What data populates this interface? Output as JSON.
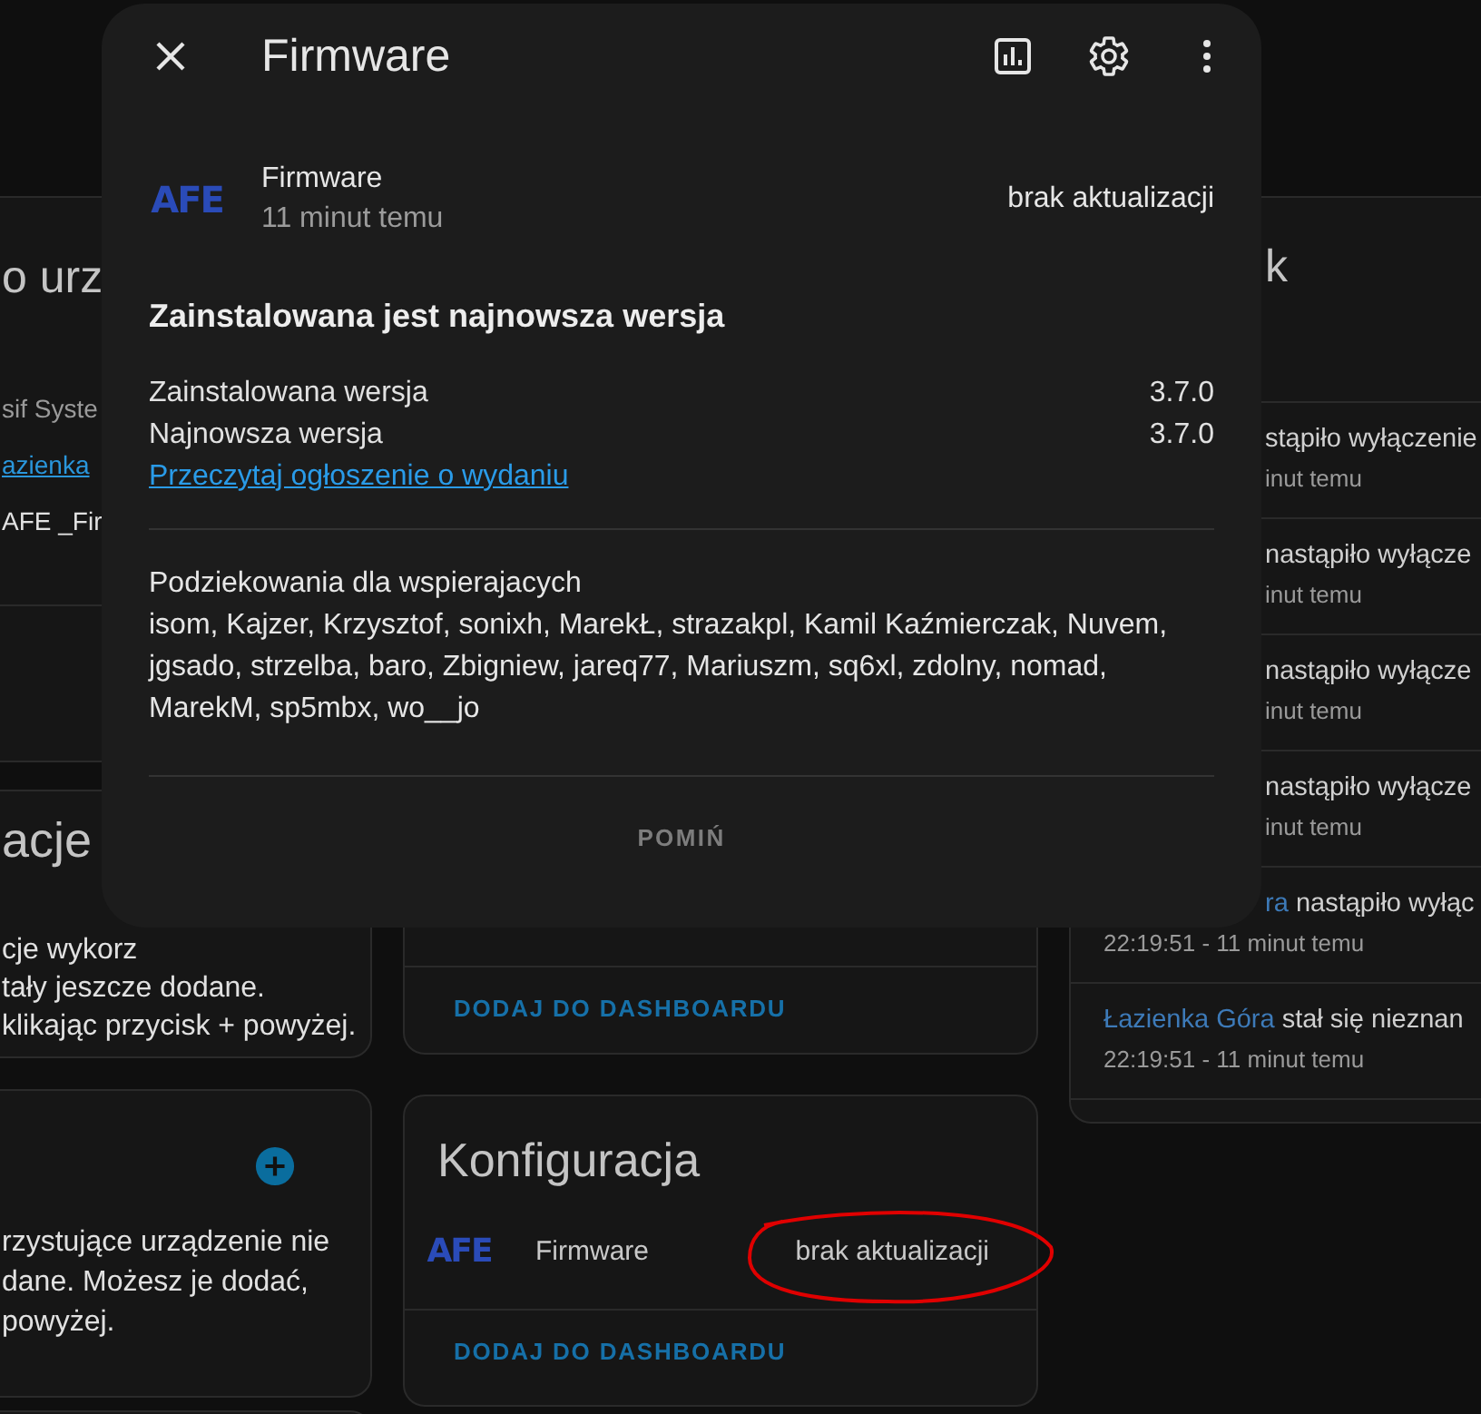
{
  "background": {
    "left_column": [
      {
        "kind": "text",
        "title": "o urz",
        "lines": [
          {
            "text": "sif Syste",
            "kind": "muted"
          },
          {
            "text": "azienka",
            "kind": "link"
          },
          {
            "text": "AFE _Fir",
            "kind": "plain"
          }
        ]
      },
      {
        "kind": "text",
        "title": "acje",
        "lines": [
          {
            "text": "cje wykorz",
            "kind": "plain"
          },
          {
            "text": "tały jeszcze dodane.",
            "kind": "plain"
          },
          {
            "text": "klikając przycisk + powyżej.",
            "kind": "plain"
          }
        ]
      },
      {
        "kind": "add",
        "lines": [
          {
            "text": "rzystujące urządzenie nie",
            "kind": "plain"
          },
          {
            "text": "dane. Możesz je dodać,",
            "kind": "plain"
          },
          {
            "text": "powyżej.",
            "kind": "plain"
          }
        ]
      },
      {
        "kind": "blank"
      }
    ],
    "middle_column": [
      {
        "action": "DODAJ DO DASHBOARDU"
      },
      {
        "title": "Konfiguracja",
        "entities": [
          {
            "logo_text": "AFE",
            "name": "Firmware",
            "state": "brak aktualizacji",
            "circled": true
          }
        ],
        "action": "DODAJ DO DASHBOARDU"
      }
    ],
    "right_column": {
      "title": "k",
      "entries": [
        {
          "message": "stąpiło wyłączenie",
          "time": "inut temu",
          "partial": true,
          "time_partial": true
        },
        {
          "message": "nastąpiło wyłącze",
          "time": "inut temu",
          "partial": true,
          "time_partial": true
        },
        {
          "message": "nastąpiło wyłącze",
          "time": "inut temu",
          "partial": true,
          "time_partial": true
        },
        {
          "message": "nastąpiło wyłącze",
          "time": "inut temu",
          "partial": true,
          "time_partial": true
        },
        {
          "entity": "ra",
          "message": "nastąpiło wyłąc",
          "time": "22:19:51 - 11 minut temu",
          "partial": true,
          "time_partial": false
        },
        {
          "entity": "Łazienka Góra",
          "message": "stał się nieznan",
          "time": "22:19:51 - 11 minut temu",
          "partial": false,
          "time_partial": false
        }
      ]
    }
  },
  "dialog": {
    "title": "Firmware",
    "entity": {
      "logo_text": "AFE",
      "name": "Firmware",
      "last_changed": "11 minut temu",
      "state": "brak aktualizacji"
    },
    "heading": "Zainstalowana jest najnowsza wersja",
    "versions": [
      {
        "label": "Zainstalowana wersja",
        "value": "3.7.0"
      },
      {
        "label": "Najnowsza wersja",
        "value": "3.7.0"
      }
    ],
    "release_notes_link": "Przeczytaj ogłoszenie o wydaniu",
    "thanks": {
      "title": "Podziekowania dla wspierajacych",
      "names": "isom, Kajzer, Krzysztof, sonixh, MarekŁ, strazakpl, Kamil Kaźmierczak, Nuvem, jgsado, strzelba, baro, Zbigniew, jareq77, Mariuszm, sq6xl, zdolny, nomad, MarekM, sp5mbx, wo__jo"
    },
    "skip_button": "POMIŃ"
  }
}
